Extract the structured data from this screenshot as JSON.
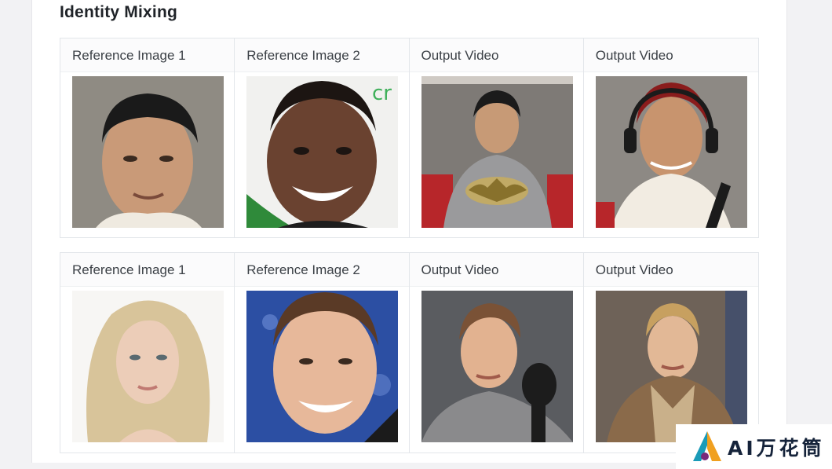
{
  "section": {
    "title": "Identity Mixing"
  },
  "rows": [
    {
      "cells": [
        {
          "label": "Reference Image 1",
          "image": "man-portrait-gray-background"
        },
        {
          "label": "Reference Image 2",
          "image": "smiling-man-portrait-white-background"
        },
        {
          "label": "Output Video",
          "image": "man-in-batman-costume-frame"
        },
        {
          "label": "Output Video",
          "image": "man-with-headphones-frame"
        }
      ]
    },
    {
      "cells": [
        {
          "label": "Reference Image 1",
          "image": "blonde-woman-portrait"
        },
        {
          "label": "Reference Image 2",
          "image": "smiling-man-blue-background"
        },
        {
          "label": "Output Video",
          "image": "man-with-microphone-frame"
        },
        {
          "label": "Output Video",
          "image": "man-in-costume-frame"
        }
      ]
    }
  ],
  "watermark": {
    "text": "AI万花筒",
    "logo": "watermark-logo"
  },
  "colors": {
    "border": "#e3e6ea",
    "title": "#1f2328",
    "label": "#3b4046"
  }
}
